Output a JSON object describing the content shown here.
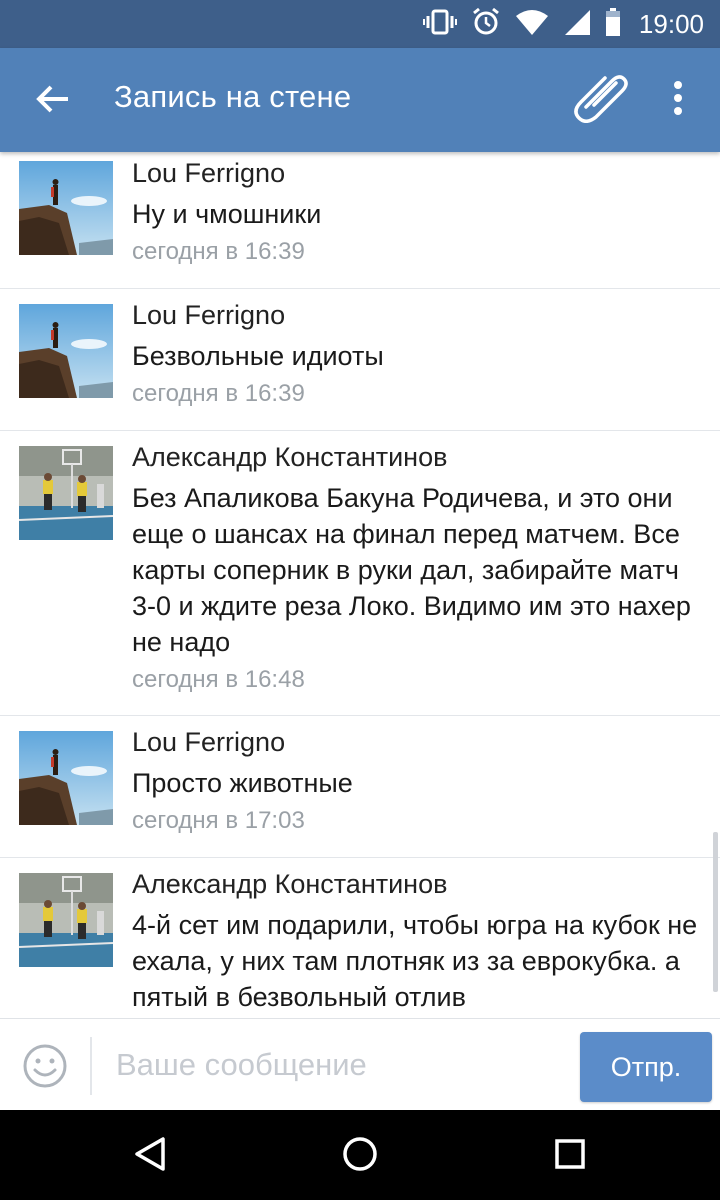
{
  "status_bar": {
    "time": "19:00",
    "icons": [
      "vibrate-icon",
      "alarm-icon",
      "wifi-icon",
      "signal-icon",
      "battery-icon"
    ]
  },
  "app_bar": {
    "title": "Запись на стене",
    "color": "#5181b8",
    "icons": [
      "back-arrow-icon",
      "paperclip-icon",
      "more-vert-icon"
    ]
  },
  "comments": [
    {
      "author": "Lou Ferrigno",
      "text": "Ну и чмошники",
      "time": "сегодня в 16:39",
      "avatar": "cliff-avatar"
    },
    {
      "author": "Lou Ferrigno",
      "text": "Безвольные идиоты",
      "time": "сегодня в 16:39",
      "avatar": "cliff-avatar"
    },
    {
      "author": "Александр Константинов",
      "text": "Без Апаликова Бакуна Родичева, и это они еще о шансах на финал перед матчем. Все карты соперник в руки дал, забирайте матч 3-0 и ждите реза Локо. Видимо им это нахер не надо",
      "time": "сегодня в 16:48",
      "avatar": "volleyball-avatar"
    },
    {
      "author": "Lou Ferrigno",
      "text": "Просто животные",
      "time": "сегодня в 17:03",
      "avatar": "cliff-avatar"
    },
    {
      "author": "Александр Константинов",
      "text": "4-й сет им подарили, чтобы югра на кубок не ехала, у них там плотняк из за еврокубка. а пятый в безвольный отлив",
      "time": "",
      "avatar": "volleyball-avatar"
    }
  ],
  "composer": {
    "placeholder": "Ваше сообщение",
    "send_label": "Отпр.",
    "emoji_icon": "smiley-icon"
  },
  "nav_bar": {
    "icons": [
      "back-triangle-icon",
      "home-circle-icon",
      "recents-square-icon"
    ]
  },
  "colors": {
    "status_bar": "#3e5f8a",
    "app_bar": "#5181b8",
    "send_button": "#5b8cc9",
    "timestamp": "#9aa0a6"
  }
}
